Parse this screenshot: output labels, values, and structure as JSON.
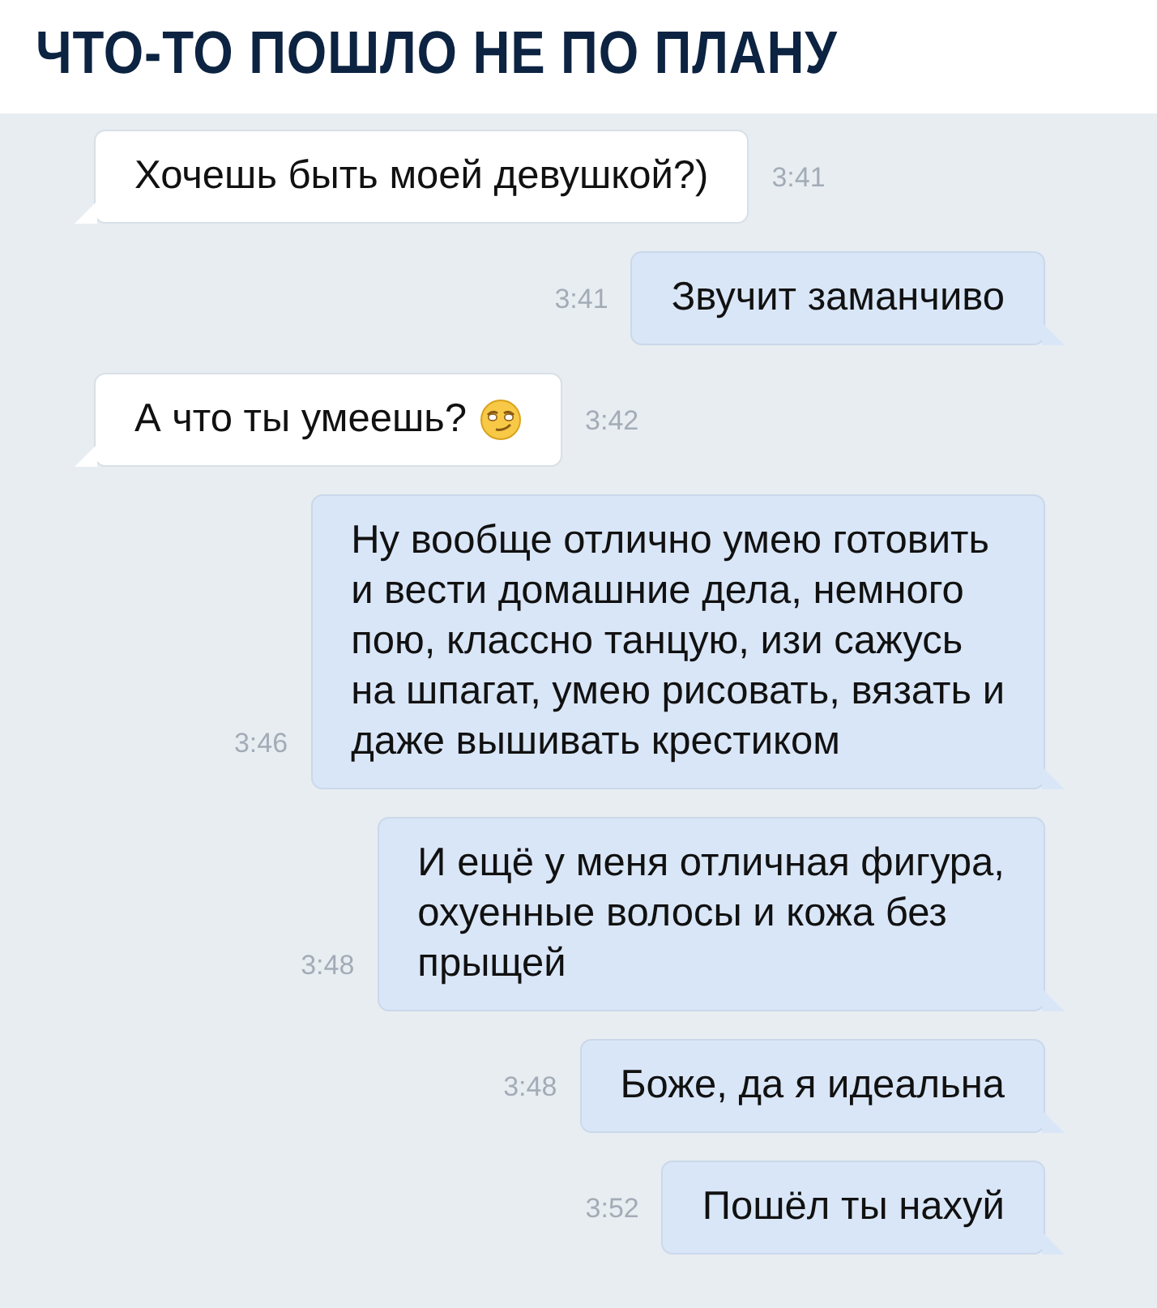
{
  "header": {
    "title": "ЧТО-ТО ПОШЛО НЕ ПО ПЛАНУ"
  },
  "messages": [
    {
      "kind": "incoming",
      "text": "Хочешь быть моей девушкой?)",
      "time": "3:41",
      "emoji": false
    },
    {
      "kind": "outgoing",
      "text": "Звучит заманчиво",
      "time": "3:41",
      "emoji": false
    },
    {
      "kind": "incoming",
      "text": "А что ты умеешь?",
      "time": "3:42",
      "emoji": true
    },
    {
      "kind": "outgoing",
      "text": "Ну вообще отлично умею готовить\nи вести домашние дела, немного\nпою, классно танцую, изи сажусь\nна шпагат, умею рисовать, вязать и\nдаже вышивать крестиком",
      "time": "3:46",
      "emoji": false
    },
    {
      "kind": "outgoing",
      "text": "И ещё у меня отличная фигура,\nохуенные волосы и кожа без\nпрыщей",
      "time": "3:48",
      "emoji": false
    },
    {
      "kind": "outgoing",
      "text": "Боже, да я идеальна",
      "time": "3:48",
      "emoji": false
    },
    {
      "kind": "outgoing",
      "text": "Пошёл ты нахуй",
      "time": "3:52",
      "emoji": false
    }
  ]
}
